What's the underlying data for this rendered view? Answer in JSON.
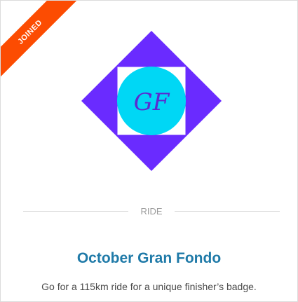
{
  "challenge": {
    "status_ribbon": "JOINED",
    "sport": "RIDE",
    "title": "October Gran Fondo",
    "description": "Go for a 115km ride for a unique finisher’s badge.",
    "badge_monogram": "GF"
  },
  "colors": {
    "ribbon": "#fc4c02",
    "badge_diamond": "#6a2bff",
    "badge_circle": "#00d7f5",
    "badge_square": "#ffffff",
    "monogram": "#5b2bd0",
    "title": "#1f7aa8",
    "description": "#4a4a4a",
    "sport_label": "#9b9b9b",
    "divider": "#d6d6d6"
  },
  "icons": {
    "badge": "gran-fondo-badge-icon",
    "monogram": "gf-monogram-icon"
  }
}
